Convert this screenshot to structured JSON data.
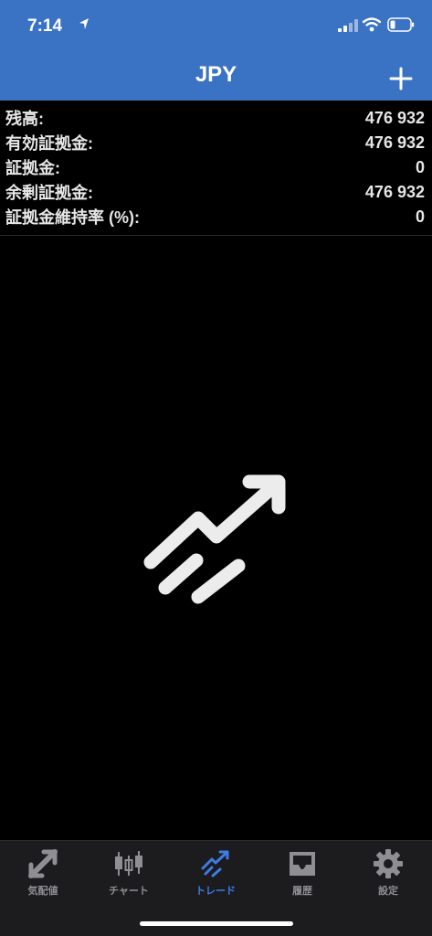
{
  "status_bar": {
    "time": "7:14",
    "icons": [
      "location-arrow-icon",
      "cellular-signal-icon",
      "wifi-icon",
      "battery-icon"
    ]
  },
  "header": {
    "title": "JPY",
    "add_icon": "plus-icon"
  },
  "account": {
    "rows": [
      {
        "label": "残高:",
        "value": "476 932"
      },
      {
        "label": "有効証拠金:",
        "value": "476 932"
      },
      {
        "label": "証拠金:",
        "value": "0"
      },
      {
        "label": "余剰証拠金:",
        "value": "476 932"
      },
      {
        "label": "証拠金維持率 (%):",
        "value": "0"
      }
    ]
  },
  "empty_state": {
    "icon": "trade-trend-icon"
  },
  "tabs": [
    {
      "label": "気配値",
      "icon": "quotes-arrows-icon",
      "active": false
    },
    {
      "label": "チャート",
      "icon": "candlestick-chart-icon",
      "active": false
    },
    {
      "label": "トレード",
      "icon": "trade-trend-icon",
      "active": true
    },
    {
      "label": "履歴",
      "icon": "history-inbox-icon",
      "active": false
    },
    {
      "label": "設定",
      "icon": "settings-gear-icon",
      "active": false
    }
  ],
  "colors": {
    "header_bg": "#3a72c4",
    "active_tab": "#3d7ce6",
    "inactive_tab": "#8e8e93",
    "tab_bar_bg": "#1c1c1e"
  }
}
